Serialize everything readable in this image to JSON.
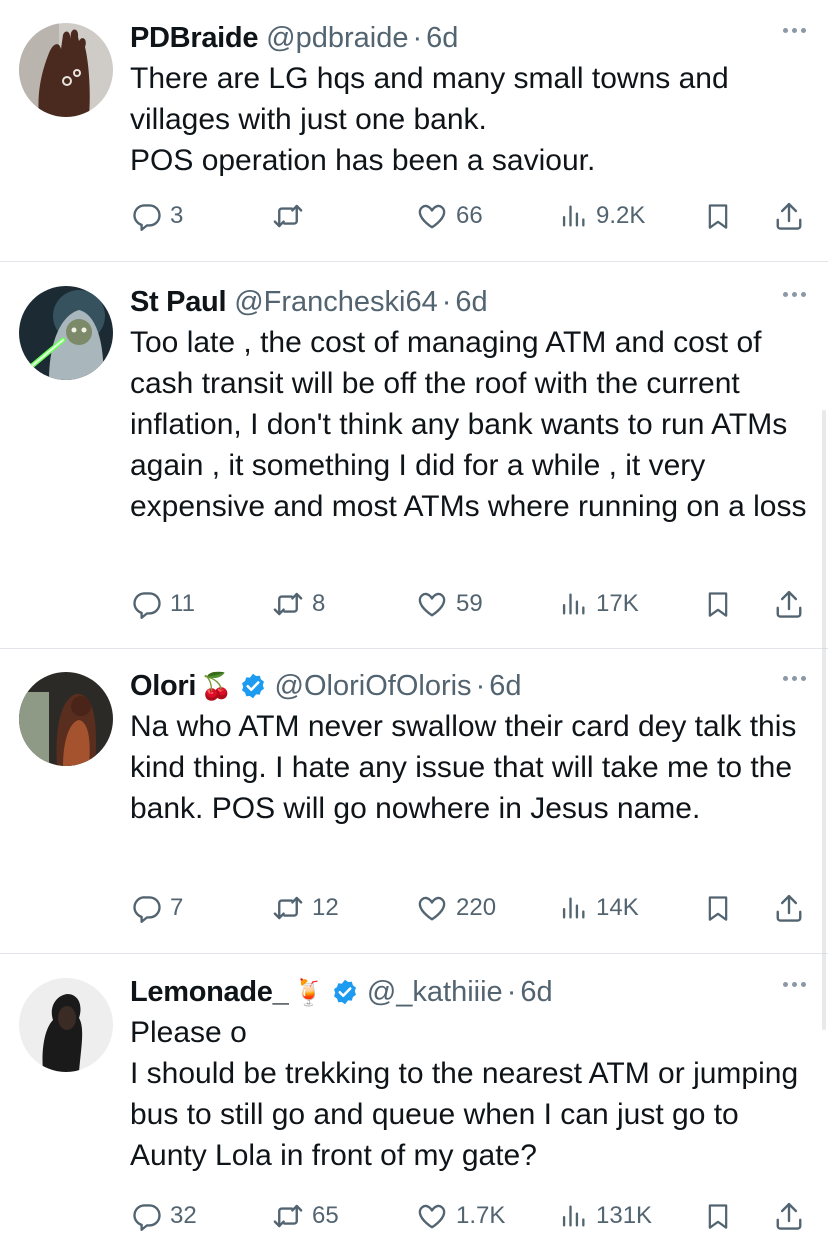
{
  "tweets": [
    {
      "name": "PDBraide",
      "emoji": "",
      "verified": false,
      "handle": "@pdbraide",
      "time": "6d",
      "lines": [
        "There are LG hqs and many small towns and villages with just one bank.",
        "POS operation has been a saviour."
      ],
      "replies": "3",
      "reposts": "",
      "likes": "66",
      "views": "9.2K"
    },
    {
      "name": "St Paul",
      "emoji": "",
      "verified": false,
      "handle": "@Francheski64",
      "time": "6d",
      "lines": [
        "Too late , the cost of managing ATM and cost of cash transit will be off the roof with the current inflation, I don't think any bank wants to run ATMs again , it something I did for a while , it very expensive and most ATMs where running on a loss"
      ],
      "replies": "11",
      "reposts": "8",
      "likes": "59",
      "views": "17K"
    },
    {
      "name": "Olori",
      "emoji": "🍒",
      "verified": true,
      "handle": "@OloriOfOloris",
      "time": "6d",
      "lines": [
        "Na who ATM never swallow their card dey talk this kind thing. I hate any issue that will take me to the bank. POS will go nowhere in Jesus name."
      ],
      "replies": "7",
      "reposts": "12",
      "likes": "220",
      "views": "14K"
    },
    {
      "name": "Lemonade_",
      "emoji": "🍹",
      "verified": true,
      "handle": "@_kathiiie",
      "time": "6d",
      "lines": [
        "Please o",
        "I should be trekking to the nearest ATM or jumping bus to still go and queue when I can just go to Aunty Lola in front of my gate?"
      ],
      "replies": "32",
      "reposts": "65",
      "likes": "1.7K",
      "views": "131K"
    }
  ],
  "colors": {
    "text": "#0f1419",
    "secondary": "#536471",
    "verified": "#1d9bf0",
    "divider": "#e1e4e8"
  },
  "icons": [
    "reply-icon",
    "repost-icon",
    "like-icon",
    "views-icon",
    "bookmark-icon",
    "share-icon",
    "more-icon",
    "verified-badge-icon"
  ]
}
